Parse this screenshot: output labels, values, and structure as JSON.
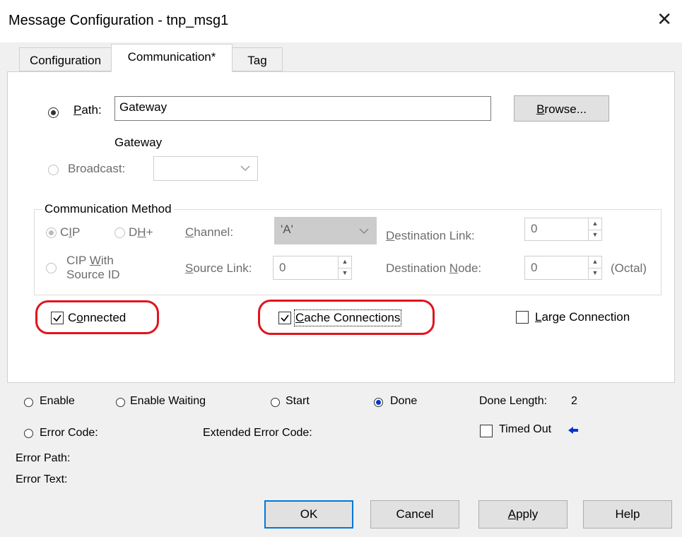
{
  "window": {
    "title": "Message Configuration - tnp_msg1"
  },
  "tabs": [
    {
      "label": "Configuration"
    },
    {
      "label": "Communication*"
    },
    {
      "label": "Tag"
    }
  ],
  "path": {
    "radio_label": "Path:",
    "value": "Gateway",
    "resolved": "Gateway",
    "browse_label": "Browse..."
  },
  "broadcast": {
    "label": "Broadcast:",
    "value": ""
  },
  "comm_method": {
    "group_label": "Communication Method",
    "cip_label": "CIP",
    "dhplus_label": "DH+",
    "cip_source_label_line1": "CIP With",
    "cip_source_label_line2": "Source ID",
    "channel_label": "Channel:",
    "channel_value": "'A'",
    "dest_link_label": "Destination Link:",
    "dest_link_value": "0",
    "source_link_label": "Source Link:",
    "source_link_value": "0",
    "dest_node_label": "Destination Node:",
    "dest_node_value": "0",
    "octal_label": "(Octal)"
  },
  "options": {
    "connected": {
      "label": "Connected",
      "checked": true
    },
    "cache_connections": {
      "label": "Cache Connections",
      "checked": true
    },
    "large_connection": {
      "label": "Large Connection",
      "checked": false
    }
  },
  "status": {
    "enable": "Enable",
    "enable_waiting": "Enable Waiting",
    "start": "Start",
    "done": "Done",
    "done_length_label": "Done Length:",
    "done_length_value": "2",
    "error_code": "Error Code:",
    "extended_error_code": "Extended Error Code:",
    "timed_out": "Timed Out",
    "error_path": "Error Path:",
    "error_text": "Error Text:"
  },
  "buttons": {
    "ok": "OK",
    "cancel": "Cancel",
    "apply": "Apply",
    "help": "Help"
  },
  "colors": {
    "highlight": "#e0141e",
    "focus": "#0078d7",
    "done_indicator": "#0033cc"
  }
}
